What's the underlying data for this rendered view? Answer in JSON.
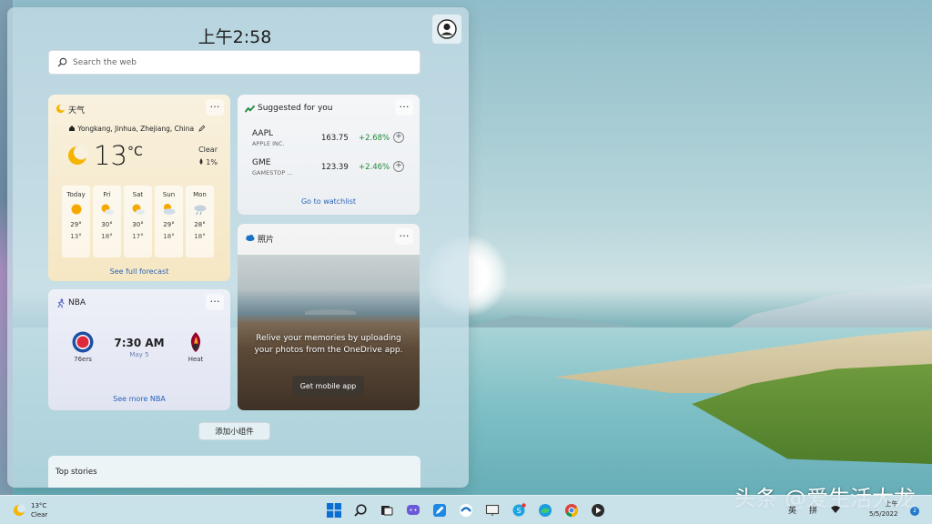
{
  "header": {
    "time": "上午2:58"
  },
  "search": {
    "placeholder": "Search the web"
  },
  "weather": {
    "title": "天气",
    "location": "Yongkang, Jinhua, Zhejiang, China",
    "temp": "13",
    "unit": "°C",
    "condition": "Clear",
    "precip": "1%",
    "forecast": [
      {
        "day": "Today",
        "hi": "29°",
        "lo": "13°",
        "icon": "sun-icon"
      },
      {
        "day": "Fri",
        "hi": "30°",
        "lo": "18°",
        "icon": "partly-cloudy-icon"
      },
      {
        "day": "Sat",
        "hi": "30°",
        "lo": "17°",
        "icon": "partly-cloudy-icon"
      },
      {
        "day": "Sun",
        "hi": "29°",
        "lo": "18°",
        "icon": "cloudy-sun-icon"
      },
      {
        "day": "Mon",
        "hi": "28°",
        "lo": "18°",
        "icon": "rain-cloud-icon"
      }
    ],
    "link": "See full forecast"
  },
  "stocks": {
    "title": "Suggested for you",
    "items": [
      {
        "symbol": "AAPL",
        "name": "APPLE INC.",
        "price": "163.75",
        "change": "+2.68%"
      },
      {
        "symbol": "GME",
        "name": "GAMESTOP ...",
        "price": "123.39",
        "change": "+2.46%"
      }
    ],
    "link": "Go to watchlist"
  },
  "photos": {
    "title": "照片",
    "message": "Relive your memories by uploading your photos from the OneDrive app.",
    "button": "Get mobile app"
  },
  "nba": {
    "title": "NBA",
    "home": "76ers",
    "away": "Heat",
    "time": "7:30 AM",
    "date": "May 5",
    "link": "See more NBA"
  },
  "add_widget": "添加小组件",
  "top_stories": "Top stories",
  "taskbar": {
    "weather_temp": "13°C",
    "weather_cond": "Clear",
    "ime_1": "英",
    "ime_2": "拼",
    "clock_time": "上午",
    "clock_date": "5/5/2022",
    "notifications": "2"
  },
  "watermark": "头条 @爱生活大龙",
  "colors": {
    "accent": "#2b64b8",
    "positive": "#1f8a3a"
  }
}
